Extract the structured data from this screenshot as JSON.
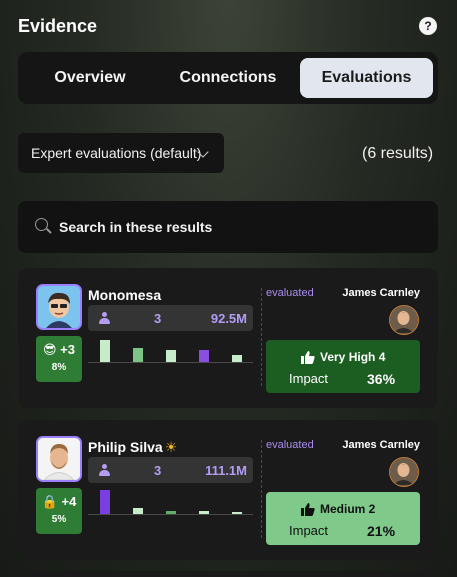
{
  "header": {
    "title": "Evidence",
    "help_label": "?"
  },
  "tabs": [
    {
      "label": "Overview",
      "active": false
    },
    {
      "label": "Connections",
      "active": false
    },
    {
      "label": "Evaluations",
      "active": true
    }
  ],
  "filter": {
    "selected": "Expert evaluations (default)"
  },
  "results": "(6 results)",
  "search": {
    "placeholder": "Search in these results"
  },
  "colors": {
    "accent": "#b39cf6",
    "impact_high": "#1c5d22",
    "impact_medium": "#7fca8a",
    "badge": "#2f7d35"
  },
  "items": [
    {
      "name": "Monomesa",
      "badge_icon": "sunglasses-emoji-icon",
      "badge_score": "+3",
      "badge_pct": "8%",
      "count": "3",
      "value": "92.5M",
      "bars": [
        {
          "level": 0.85,
          "color": "#c7ecca"
        },
        {
          "level": 0.55,
          "color": "#7cc486"
        },
        {
          "level": 0.48,
          "color": "#c7ecca"
        },
        {
          "level": 0.48,
          "color": "#8a4fe0"
        },
        {
          "level": 0.25,
          "color": "#c7ecca"
        }
      ],
      "evaluated_label": "evaluated",
      "evaluator": "James Carnley",
      "impact_level": "Very High 4",
      "impact_label": "Impact",
      "impact_pct": "36%"
    },
    {
      "name": "Philip Silva",
      "name_suffix_icon": "sun-icon",
      "badge_icon": "lock-icon",
      "badge_score": "+4",
      "badge_pct": "5%",
      "count": "3",
      "value": "111.1M",
      "bars": [
        {
          "level": 0.92,
          "color": "#7a3fe0"
        },
        {
          "level": 0.22,
          "color": "#c7ecca"
        },
        {
          "level": 0.1,
          "color": "#5fae69"
        },
        {
          "level": 0.12,
          "color": "#c7ecca"
        },
        {
          "level": 0.08,
          "color": "#c7ecca"
        }
      ],
      "evaluated_label": "evaluated",
      "evaluator": "James Carnley",
      "impact_level": "Medium 2",
      "impact_label": "Impact",
      "impact_pct": "21%"
    }
  ]
}
